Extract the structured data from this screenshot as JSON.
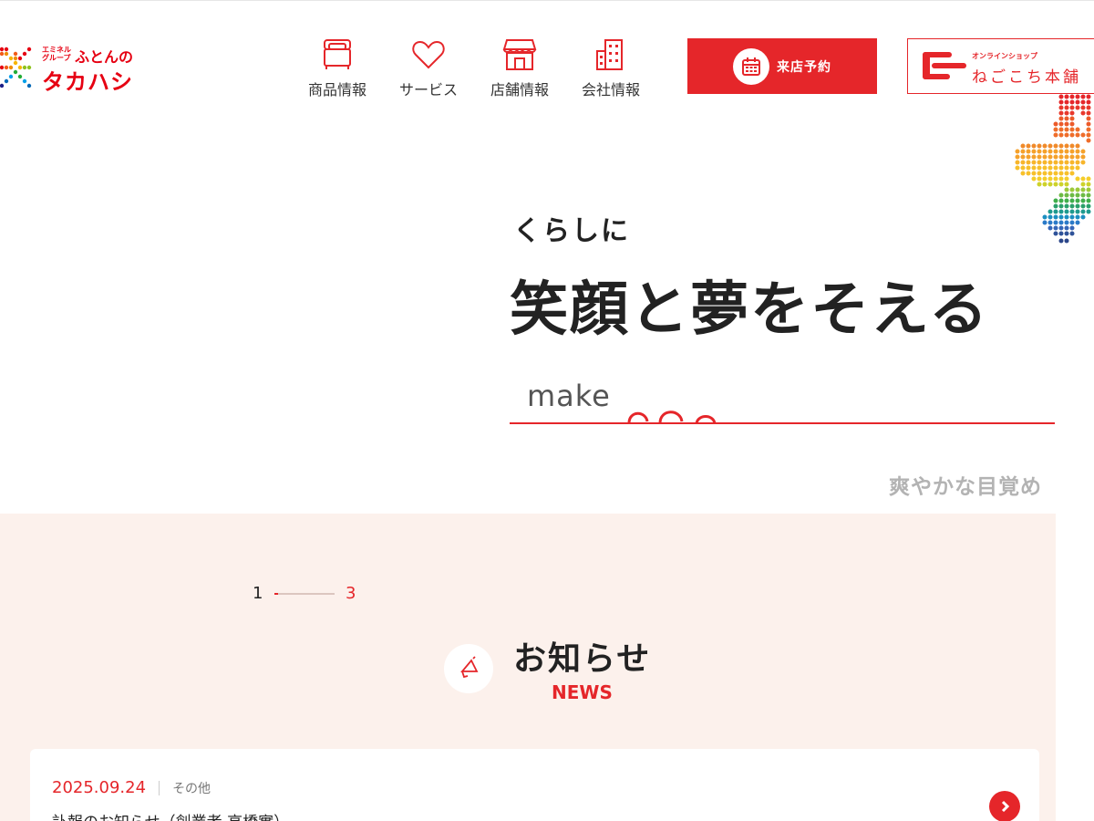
{
  "brand": {
    "group_label": "エミネル グループ",
    "futon_label": "ふとんの",
    "name": "タカハシ"
  },
  "nav": [
    {
      "label": "商品情報",
      "icon": "bed-icon"
    },
    {
      "label": "サービス",
      "icon": "heart-icon"
    },
    {
      "label": "店舗情報",
      "icon": "store-icon"
    },
    {
      "label": "会社情報",
      "icon": "building-icon"
    }
  ],
  "buttons": {
    "reserve": {
      "label": "来店予約",
      "icon": "calendar-icon"
    },
    "shop": {
      "sub_label": "オンラインショップ",
      "label": "ねごこち本舗",
      "icon": "shop-logo-icon"
    }
  },
  "hero": {
    "lead": "くらしに",
    "headline": "笑顔と夢をそえる",
    "make_text": "make",
    "caption": "爽やかな目覚め"
  },
  "slider": {
    "current": "1",
    "total": "3",
    "progress": 0.05
  },
  "news": {
    "title": "お知らせ",
    "title_en": "NEWS",
    "icon": "megaphone-icon",
    "items": [
      {
        "date": "2025.09.24",
        "category": "その他",
        "text": "訃報のお知らせ（創業者 高橋實）"
      }
    ]
  },
  "colors": {
    "accent": "#e5262a",
    "news_bg": "#fcf1ec",
    "caption_gray": "#b3b3b3"
  }
}
